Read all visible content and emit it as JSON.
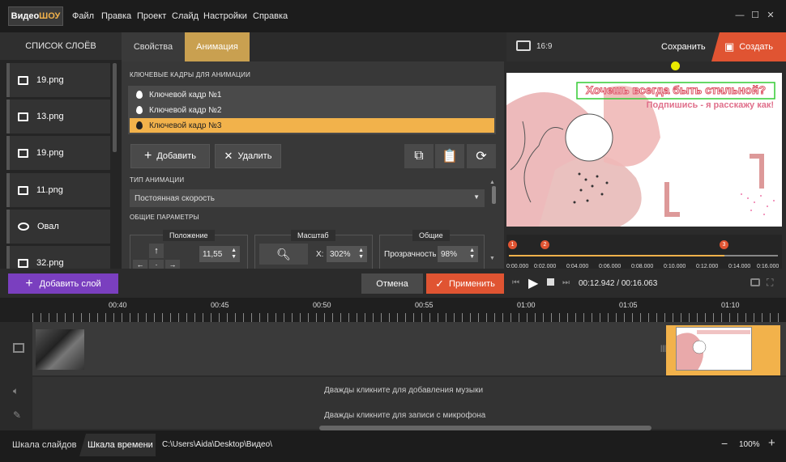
{
  "app": {
    "logo_part1": "Видео",
    "logo_part2": "ШОУ"
  },
  "menu": [
    "Файл",
    "Правка",
    "Проект",
    "Слайд",
    "Настройки",
    "Справка"
  ],
  "layers": {
    "header": "СПИСОК СЛОЁВ",
    "items": [
      {
        "label": "19.png",
        "icon": "image-icon"
      },
      {
        "label": "13.png",
        "icon": "image-icon"
      },
      {
        "label": "19.png",
        "icon": "image-icon"
      },
      {
        "label": "11.png",
        "icon": "image-icon"
      },
      {
        "label": "Овал",
        "icon": "oval-icon"
      },
      {
        "label": "32.png",
        "icon": "image-icon"
      }
    ],
    "add_label": "Добавить слой"
  },
  "tabs": {
    "props": "Свойства",
    "anim": "Анимация"
  },
  "keyframes": {
    "title": "КЛЮЧЕВЫЕ КАДРЫ ДЛЯ АНИМАЦИИ",
    "items": [
      "Ключевой кадр №1",
      "Ключевой кадр №2",
      "Ключевой кадр №3"
    ],
    "add": "Добавить",
    "delete": "Удалить"
  },
  "anim_type": {
    "title": "ТИП АНИМАЦИИ",
    "value": "Постоянная скорость"
  },
  "general": {
    "title": "ОБЩИЕ ПАРАМЕТРЫ",
    "position_label": "Положение",
    "position_value": "11,55",
    "scale_label": "Масштаб",
    "scale_axis": "X:",
    "scale_value": "302%",
    "common_label": "Общие",
    "opacity_label": "Прозрачность",
    "opacity_value": "98%"
  },
  "preview": {
    "ratio": "16:9",
    "save": "Сохранить",
    "create": "Создать",
    "text1": "Хочешь всегда быть стильной?",
    "text2": "Подпишись - я расскажу как!"
  },
  "mini_timeline": {
    "ticks": [
      "0:00.000",
      "0:02.000",
      "0:04.000",
      "0:06.000",
      "0:08.000",
      "0:10.000",
      "0:12.000",
      "0:14.000",
      "0:16.000"
    ],
    "markers": [
      "1",
      "2",
      "3"
    ]
  },
  "actions": {
    "cancel": "Отмена",
    "apply": "Применить",
    "timecode": "00:12.942 / 00:16.063"
  },
  "timeline": {
    "ruler": [
      "00:40",
      "00:45",
      "00:50",
      "00:55",
      "01:00",
      "01:05",
      "01:10"
    ],
    "music_hint": "Дважды кликните для добавления музыки",
    "mic_hint": "Дважды кликните для записи с микрофона"
  },
  "status": {
    "tab_slides": "Шкала слайдов",
    "tab_time": "Шкала времени",
    "path": "C:\\Users\\Aida\\Desktop\\Видео\\",
    "zoom": "100%"
  },
  "colors": {
    "accent": "#f2b24b",
    "orange": "#e05432",
    "purple": "#7a3fbf"
  }
}
